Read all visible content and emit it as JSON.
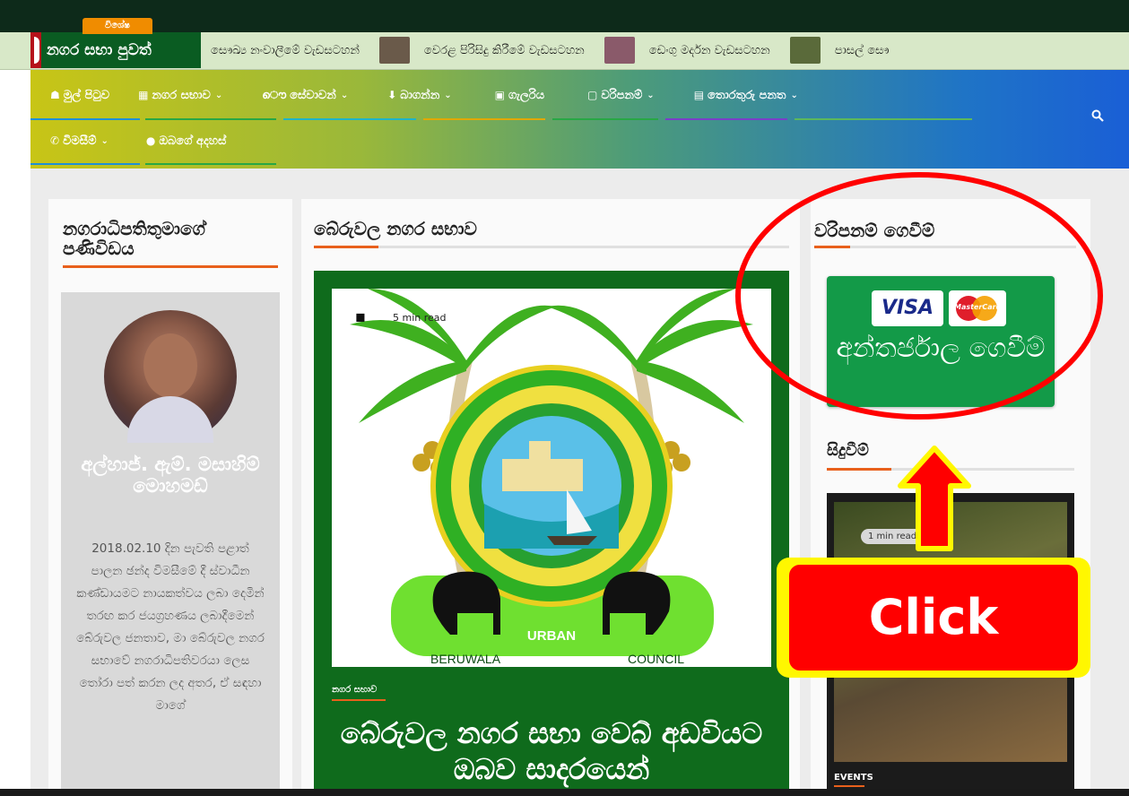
{
  "ticker": {
    "badge": "විශේෂ",
    "title": "නගර සභා පුවත්",
    "items": [
      {
        "label": "සෞඛ්‍ය නංවාලීමේ වැඩසටහන්",
        "thumb": ""
      },
      {
        "label": "වෙරළ පිරිසිදු කිරීමේ වැඩසටහන",
        "thumb": "#6a5a4a"
      },
      {
        "label": "ඩෙංගු මර්දන වැඩසටහන",
        "thumb": "#8a5a6a"
      },
      {
        "label": "පාසල් සෞ",
        "thumb": "#5a6a3a"
      }
    ]
  },
  "nav": {
    "row1": [
      {
        "icon": "☗",
        "label": "මුල් පිටුව",
        "chevron": false,
        "underline": "#1f8fd6"
      },
      {
        "icon": "▦",
        "label": "නගර සභාව",
        "chevron": true,
        "underline": "#28a745"
      },
      {
        "icon": "ൌ",
        "label": "සේවාවන්",
        "chevron": true,
        "underline": "#1fb3c8"
      },
      {
        "icon": "⬇",
        "label": "බාගන්න",
        "chevron": true,
        "underline": "#e0a800"
      },
      {
        "icon": "▣",
        "label": "ගැලරිය",
        "chevron": false,
        "underline": "#28a745"
      },
      {
        "icon": "▢",
        "label": "වරිපනම්",
        "chevron": true,
        "underline": "#7a3fc8"
      },
      {
        "icon": "▤",
        "label": "තොරතුරු පනත",
        "chevron": true,
        "underline": "#5cb85c"
      }
    ],
    "row2": [
      {
        "icon": "✆",
        "label": "විමසීම්",
        "chevron": true,
        "underline": "#1f8fd6"
      },
      {
        "icon": "●",
        "label": "ඔබගේ අදහස්",
        "chevron": false,
        "underline": "#28a745"
      }
    ],
    "search_icon": "search-icon"
  },
  "left": {
    "title": "නගරාධිපතිතුමාගේ පණිවිඩය",
    "name": "අල්හාජ්. ඇම්. මසාහිම් මොහමඩ්",
    "bio": "2018.02.10 දින පැවති පළාත් පාලන ඡන්ද විමසීමේ දී ස්වාධීන කණ්ඩායමට නායකත්වය ලබා දෙමින් තරඟ කර ජයග්‍රහණය ලබාදීමෙන් බේරුවල ජනතාව, මා බේරුවල නගර සභාවේ නගරාධිපතිවරයා ලෙස තෝරා පත් කරන ලද අතර, ඒ සඳහා මාගේ"
  },
  "middle": {
    "title": "බේරුවල නගර සභාව",
    "read_time": "5 min read",
    "logo_text_top": "URBAN",
    "logo_text_left": "BERUWALA",
    "logo_text_right": "COUNCIL",
    "category": "නගර සභාව",
    "headline": "බේරුවල නගර සභා වෙබ් අඩවියට ඔබව සාදරයෙන්"
  },
  "right": {
    "title": "වරිපනම් ගෙවීම්",
    "visa": "VISA",
    "mastercard": "MasterCard",
    "pay_text": "අන්තර්ජාල ගෙවීම්",
    "events_title": "සිදුවීම්",
    "events_read_time": "1 min read",
    "events_category": "EVENTS"
  },
  "annotation": {
    "click_label": "Click"
  },
  "colors": {
    "topbar": "#0d2a1a",
    "feature_bg": "#0f6b1c",
    "accent": "#e8601c",
    "pay_green": "#139a48",
    "annotation_red": "#ff0000",
    "annotation_yellow": "#fff700"
  }
}
